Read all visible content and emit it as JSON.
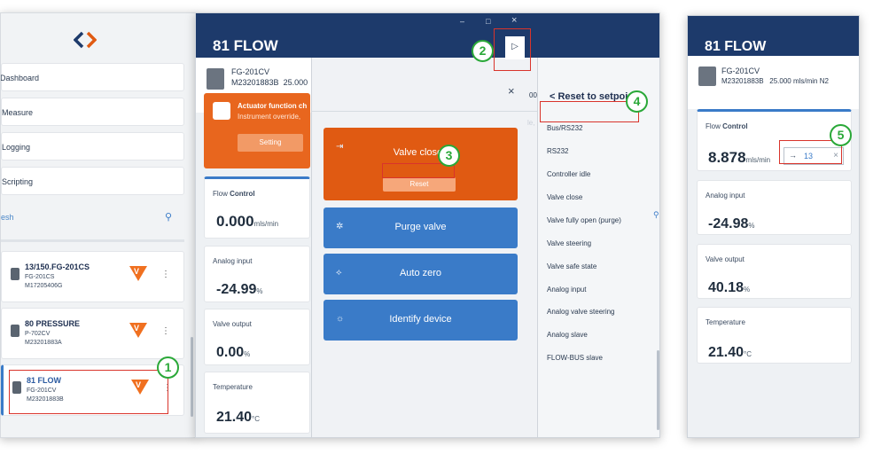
{
  "sidebar": {
    "nav": [
      "Dashboard",
      "Measure",
      "Logging",
      "Scripting"
    ],
    "search_placeholder": "esh",
    "devices": [
      {
        "name": "13/150.FG-201CS",
        "model": "FG-201CS",
        "serial": "M17205406G"
      },
      {
        "name": "80 PRESSURE",
        "model": "P-702CV",
        "serial": "M23201883A"
      },
      {
        "name": "81 FLOW",
        "model": "FG-201CV",
        "serial": "M23201883B"
      }
    ],
    "badge_glyph": "V",
    "kebab": "⋮"
  },
  "main": {
    "title": "81 FLOW",
    "window_controls": [
      "–",
      "□",
      "×"
    ],
    "device_model": "FG-201CV",
    "device_serial": "M23201883B",
    "device_serial_suffix": "25.000",
    "alert": {
      "title": "Actuator function ch",
      "subtitle": "Instrument override,",
      "button": "Setting"
    },
    "flow": {
      "label_prefix": "Flow ",
      "label_strong": "Control",
      "value": "0.000",
      "unit": "mls/min"
    },
    "analog": {
      "label": "Analog input",
      "value": "-24.99",
      "unit": "%"
    },
    "valve": {
      "label": "Valve output",
      "value": "0.00",
      "unit": "%"
    },
    "temp": {
      "label": "Temperature",
      "value": "21.40",
      "unit": "°C"
    }
  },
  "actions": {
    "close": "×",
    "valve_closed": "Valve closed",
    "reset": "Reset",
    "purge": "Purge valve",
    "autozero": "Auto zero",
    "identify": "Identify device",
    "expand": "▷"
  },
  "setpoint_list": {
    "title": "< Reset to setpoint s",
    "items": [
      "Bus/RS232",
      "RS232",
      "Controller idle",
      "Valve close",
      "Valve fully open (purge)",
      "Valve steering",
      "Valve safe state",
      "Analog input",
      "Analog valve steering",
      "Analog slave",
      "FLOW-BUS slave"
    ],
    "overflow_left": "00",
    "overflow_left2": "le,"
  },
  "right": {
    "title": "81 FLOW",
    "device_model": "FG-201CV",
    "device_info": "M23201883B   25.000 mls/min N2",
    "flow": {
      "label_prefix": "Flow ",
      "label_strong": "Control",
      "value": "8.878",
      "unit": "mls/min"
    },
    "setpoint_value": "13",
    "analog": {
      "label": "Analog input",
      "value": "-24.98",
      "unit": "%"
    },
    "valve": {
      "label": "Valve output",
      "value": "40.18",
      "unit": "%"
    },
    "temp": {
      "label": "Temperature",
      "value": "21.40",
      "unit": "°C"
    }
  },
  "callouts": [
    "1",
    "2",
    "3",
    "4",
    "5"
  ]
}
